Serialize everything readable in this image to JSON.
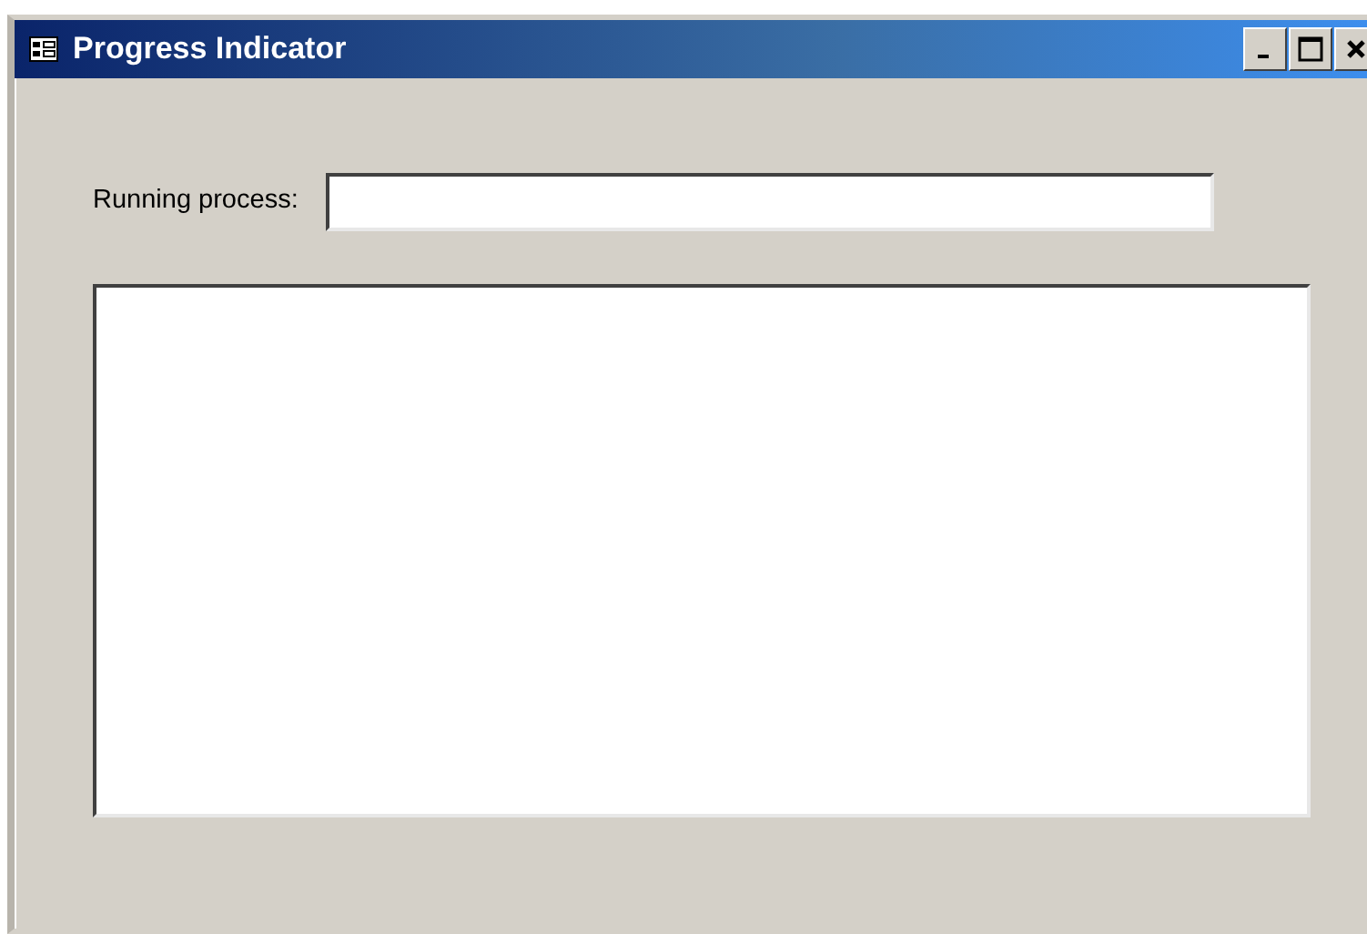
{
  "window": {
    "title": "Progress Indicator"
  },
  "form": {
    "running_process": {
      "label": "Running process:"
    }
  }
}
